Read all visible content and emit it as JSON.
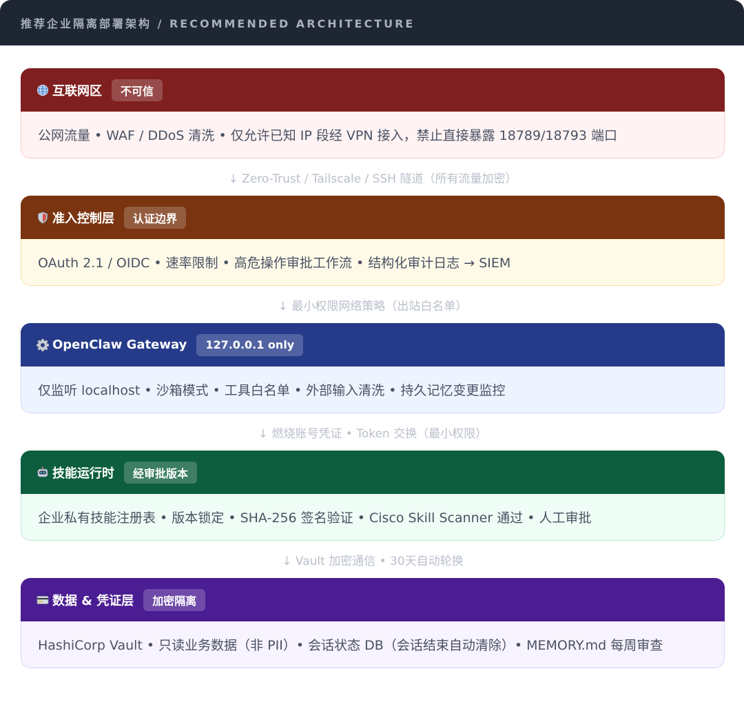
{
  "header": {
    "title": "推荐企业隔离部署架构 / RECOMMENDED ARCHITECTURE"
  },
  "layers": [
    {
      "icon": "globe-icon",
      "title": "互联网区",
      "badge": "不可信",
      "body": "公网流量 • WAF / DDoS 清洗 • 仅允许已知 IP 段经 VPN 接入，禁止直接暴露 18789/18793 端口"
    },
    {
      "icon": "shield-icon",
      "title": "准入控制层",
      "badge": "认证边界",
      "body": "OAuth 2.1 / OIDC • 速率限制 • 高危操作审批工作流 • 结构化审计日志 → SIEM"
    },
    {
      "icon": "gear-icon",
      "title": "OpenClaw Gateway",
      "badge": "127.0.0.1 only",
      "body": "仅监听 localhost • 沙箱模式 • 工具白名单 • 外部输入清洗 • 持久记忆变更监控"
    },
    {
      "icon": "robot-icon",
      "title": "技能运行时",
      "badge": "经审批版本",
      "body": "企业私有技能注册表 • 版本锁定 • SHA-256 签名验证 • Cisco Skill Scanner 通过 • 人工审批"
    },
    {
      "icon": "card-icon",
      "title": "数据 & 凭证层",
      "badge": "加密隔离",
      "body": "HashiCorp Vault • 只读业务数据（非 PII）• 会话状态 DB（会话结束自动清除）• MEMORY.md 每周审查"
    }
  ],
  "connectors": [
    "↓ Zero-Trust / Tailscale / SSH 隧道（所有流量加密）",
    "↓ 最小权限网络策略（出站白名单）",
    "↓ 燃烧账号凭证 • Token 交换（最小权限）",
    "↓ Vault 加密通信 • 30天自动轮换"
  ],
  "colors": {
    "header_bg": "#1e2533",
    "internet": "#7f1f1f",
    "access": "#7a3410",
    "gateway": "#253b8a",
    "runtime": "#0d5e3e",
    "data": "#4b1d93"
  }
}
